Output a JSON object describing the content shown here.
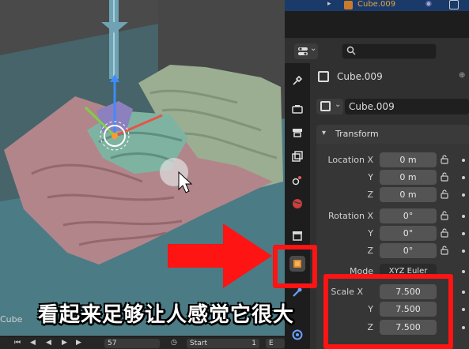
{
  "outliner": {
    "object_name": "Cube.009"
  },
  "viewport": {
    "object_name": "Cube"
  },
  "timeline": {
    "current_frame": "57",
    "start_label": "Start",
    "start_value": "1",
    "end_label": "E"
  },
  "properties": {
    "object_header": "Cube.009",
    "object_selector": "Cube.009",
    "transform": {
      "title": "Transform",
      "location": {
        "label_x": "Location X",
        "label_y": "Y",
        "label_z": "Z",
        "x": "0 m",
        "y": "0 m",
        "z": "0 m"
      },
      "rotation": {
        "label_x": "Rotation X",
        "label_y": "Y",
        "label_z": "Z",
        "x": "0°",
        "y": "0°",
        "z": "0°"
      },
      "mode": {
        "label": "Mode",
        "value": "XYZ Euler"
      },
      "scale": {
        "label_x": "Scale X",
        "label_y": "Y",
        "label_z": "Z",
        "x": "7.500",
        "y": "7.500",
        "z": "7.500"
      }
    }
  },
  "subtitle": "看起来足够让人感觉它很大",
  "colors": {
    "annotation_red": "#ff1414",
    "active_tab": "#e08a2c",
    "panel_bg": "#303030",
    "field_bg": "#545454"
  }
}
